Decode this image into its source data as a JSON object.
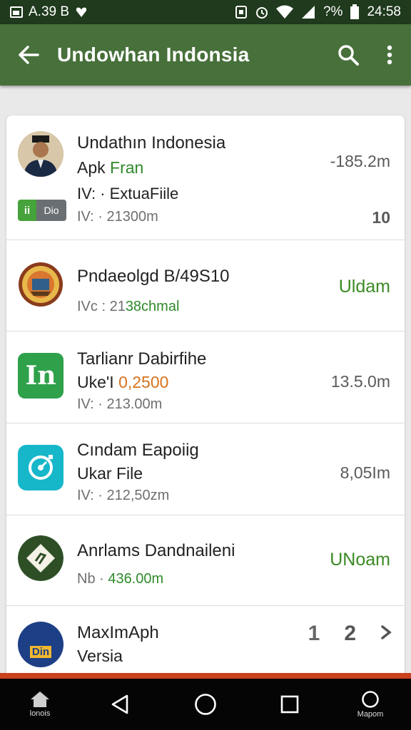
{
  "status_bar": {
    "left_text": "A.39 B",
    "battery_percent": "?%",
    "time": "24:58"
  },
  "app_bar": {
    "title": "Undowhan Indonsia",
    "back_icon": "arrow-left-icon",
    "search_icon": "search-icon",
    "menu_icon": "more-vert-icon"
  },
  "items": [
    {
      "title": "Undathın Indonesia",
      "line2_a": "Apk ",
      "line2_b": "Fran",
      "line3": "IV: · ExtuaFiile",
      "meta": "IV: · 21300m",
      "right": "-185.2m",
      "right2": "10",
      "badge_a": "ii",
      "badge_b": "Dio",
      "logo_icon": "person-avatar-icon"
    },
    {
      "title": "Pndaeolgd B/49S10",
      "meta_a": "IVc : 21",
      "meta_b": "38chmal",
      "right": "Uldam",
      "logo_icon": "seal-emblem-icon"
    },
    {
      "title": "Tarlianr Dabirfihe",
      "line2_a": "Uke'I ",
      "line2_b": "0,2500",
      "meta": "IV: · 213.00m",
      "right": "13.5.0m",
      "logo_text": "In",
      "logo_icon": "in-app-icon"
    },
    {
      "title": "Cındam Eapoiig",
      "line2": "Ukar File",
      "meta": "IV: · 212,50zm",
      "right": "8,05Im",
      "logo_icon": "timer-app-icon"
    },
    {
      "title": "Anrlams Dandnaileni",
      "meta_a": "Nb ·",
      "meta_b": "436.00m",
      "right": "UNoam",
      "logo_icon": "diamond-leaf-icon"
    },
    {
      "title": "MaxImAph",
      "line2": "Versia",
      "logo_text": "Din",
      "logo_icon": "book-app-icon",
      "pager": [
        "1",
        "2"
      ],
      "pager_next_icon": "chevron-right-icon"
    }
  ],
  "nav": {
    "left_label": "lonois",
    "right_label": "Mapom",
    "left_icon": "home-icon",
    "back_icon": "triangle-back-icon",
    "home_icon": "circle-home-icon",
    "recents_icon": "square-recents-icon",
    "right_icon": "circle-account-icon"
  },
  "colors": {
    "app_bar": "#47703a",
    "status_bar": "#1f3a1d",
    "accent_green": "#2f8a2a",
    "nav_bar": "#050505"
  }
}
